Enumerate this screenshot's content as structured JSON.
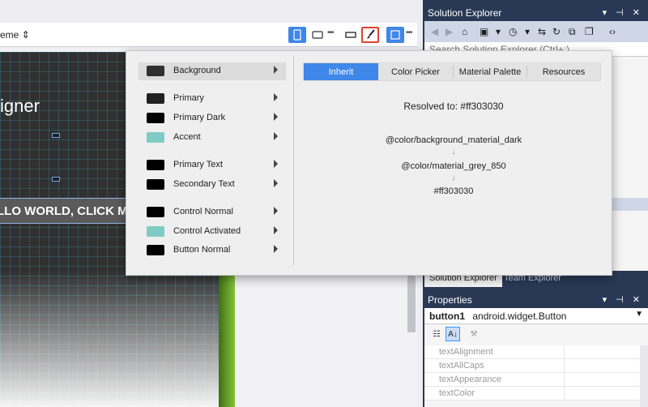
{
  "designer": {
    "theme_label": "eme ⇕",
    "phone_title": "igner",
    "phone_button": "LLO WORLD, CLICK ME"
  },
  "solution_explorer": {
    "title": "Solution Explorer",
    "search_placeholder": "Search Solution Explorer (Ctrl+;)",
    "tabs": [
      "Solution Explorer",
      "Team Explorer"
    ]
  },
  "properties": {
    "title": "Properties",
    "object_name": "button1",
    "object_type": "android.widget.Button",
    "rows": [
      "textAlignment",
      "textAllCaps",
      "textAppearance",
      "textColor"
    ]
  },
  "theme_editor": {
    "properties": [
      {
        "label": "Background",
        "color": "#303030",
        "selected": true
      },
      {
        "label": "Primary",
        "color": "#212121",
        "selected": false
      },
      {
        "label": "Primary Dark",
        "color": "#000000",
        "selected": false
      },
      {
        "label": "Accent",
        "color": "#80cbc4",
        "selected": false
      },
      {
        "label": "Primary Text",
        "color": "#000000",
        "selected": false
      },
      {
        "label": "Secondary Text",
        "color": "#000000",
        "selected": false
      },
      {
        "label": "Control Normal",
        "color": "#000000",
        "selected": false
      },
      {
        "label": "Control Activated",
        "color": "#80cbc4",
        "selected": false
      },
      {
        "label": "Button Normal",
        "color": "#000000",
        "selected": false
      }
    ],
    "tabs": [
      "Inherit",
      "Color Picker",
      "Material Palette",
      "Resources"
    ],
    "active_tab": "Inherit",
    "resolved_text": "Resolved to: #ff303030",
    "chain": [
      "@color/background_material_dark",
      "@color/material_grey_850",
      "#ff303030"
    ],
    "chain_arrow": "↓"
  },
  "colors": {
    "accent_blue": "#3f87e8",
    "vs_dark": "#293955",
    "selected_border": "#e0422f"
  }
}
